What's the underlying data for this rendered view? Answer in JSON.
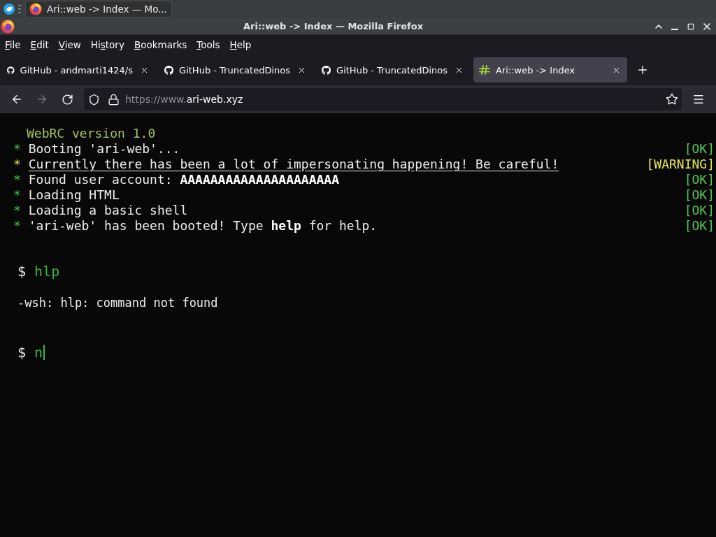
{
  "taskbar": {
    "tasks": [
      {
        "title": "Ari::web -> Index — Mo...",
        "selected": true
      }
    ]
  },
  "window": {
    "title": "Ari::web -> Index — Mozilla Firefox"
  },
  "menu_bar": [
    {
      "access_key": "F",
      "suffix": "ile"
    },
    {
      "access_key": "E",
      "suffix": "dit"
    },
    {
      "access_key": "V",
      "suffix": "iew"
    },
    {
      "prefix": "Hi",
      "access_key": "s",
      "suffix": "tory"
    },
    {
      "access_key": "B",
      "suffix": "ookmarks"
    },
    {
      "access_key": "T",
      "suffix": "ools"
    },
    {
      "access_key": "H",
      "suffix": "elp"
    }
  ],
  "tabs": [
    {
      "kind": "github",
      "title": "GitHub - andmarti1424/s",
      "selected": false
    },
    {
      "kind": "github",
      "title": "GitHub - TruncatedDinos",
      "selected": false
    },
    {
      "kind": "github",
      "title": "GitHub - TruncatedDinos",
      "selected": false
    },
    {
      "kind": "site",
      "title": "Ari::web -> Index",
      "selected": true
    }
  ],
  "toolbar": {
    "back": {
      "disabled": false
    },
    "forward": {
      "disabled": true
    },
    "url": {
      "dimmed": "https://www.",
      "domain": "ari-web.xyz"
    }
  },
  "terminal": {
    "banner": "WebRC version 1.0",
    "boot_log": [
      {
        "kind": "ok",
        "marker": "*",
        "message": "Booting 'ari-web'...",
        "status": "[OK]"
      },
      {
        "kind": "warning",
        "marker": "*",
        "message": "Currently there has been a lot of impersonating happening! Be careful!",
        "status": "[WARNING]"
      },
      {
        "kind": "ok",
        "marker": "*",
        "message": "Found user account: **AAAAAAAAAAAAAAAAAAAAA**",
        "status": "[OK]"
      },
      {
        "kind": "ok",
        "marker": "*",
        "message": "Loading HTML",
        "status": "[OK]"
      },
      {
        "kind": "ok",
        "marker": "*",
        "message": "Loading a basic shell",
        "status": "[OK]"
      },
      {
        "kind": "ok",
        "marker": "*",
        "message": "'ari-web' has been booted! Type **help** for help.",
        "status": "[OK]"
      }
    ],
    "history": [
      {
        "kind": "command",
        "prompt": "$",
        "text": "hlp"
      },
      {
        "kind": "output",
        "text": "-wsh: hlp: command not found"
      }
    ],
    "input": {
      "prompt": "$",
      "value": "n"
    }
  }
}
